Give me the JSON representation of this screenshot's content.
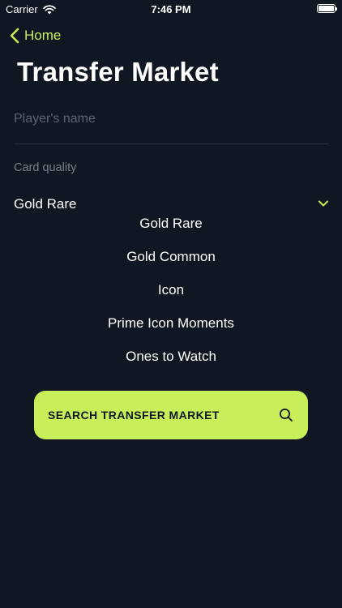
{
  "status_bar": {
    "carrier": "Carrier",
    "time": "7:46 PM"
  },
  "nav": {
    "back_label": "Home"
  },
  "title": "Transfer Market",
  "player_name": {
    "placeholder": "Player's name",
    "value": ""
  },
  "card_quality": {
    "label": "Card quality",
    "selected": "Gold Rare",
    "options": [
      "Gold Rare",
      "Gold Common",
      "Icon",
      "Prime Icon Moments",
      "Ones to Watch"
    ]
  },
  "search_button": {
    "label": "SEARCH TRANSFER MARKET"
  },
  "colors": {
    "background": "#111722",
    "accent": "#c6ef5a",
    "muted_text": "#7a808a"
  }
}
